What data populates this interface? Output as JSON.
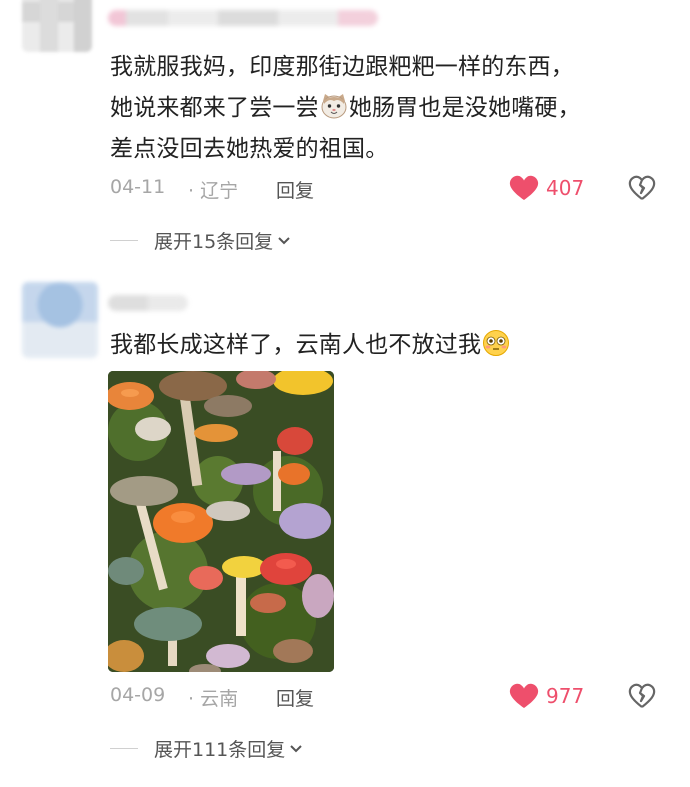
{
  "comments": [
    {
      "text_segments": [
        "我就服我妈，印度那街边跟粑粑一样的东西，\n她说来都来了尝一尝",
        "她肠胃也是没她嘴硬，\n差点没回去她热爱的祖国。"
      ],
      "emoji": "cat-face-emoji",
      "date": "04-11",
      "location": "· 辽宁",
      "reply_label": "回复",
      "likes": "407",
      "expand_label": "展开15条回复"
    },
    {
      "text_segments": [
        "我都长成这样了，云南人也不放过我"
      ],
      "emoji": "flushed-face-emoji",
      "image": "mushroom-photo",
      "date": "04-09",
      "location": "· 云南",
      "reply_label": "回复",
      "likes": "977",
      "expand_label": "展开111条回复"
    }
  ],
  "icons": {
    "like": "heart-icon",
    "dislike": "broken-heart-icon",
    "expand": "chevron-down-icon"
  },
  "colors": {
    "like": "#ee4f6c",
    "meta": "#a6a6a6",
    "text": "#222222"
  }
}
